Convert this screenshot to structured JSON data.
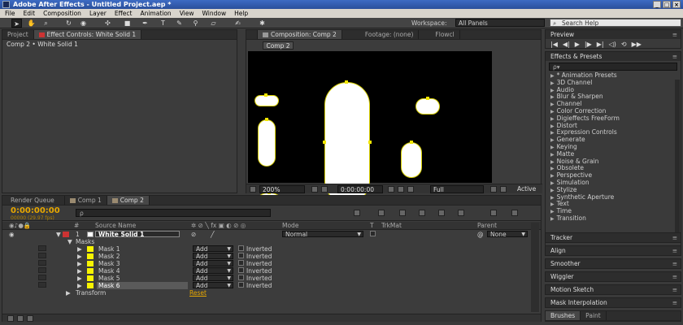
{
  "title_bar": {
    "text": "Adobe After Effects - Untitled Project.aep *"
  },
  "menu": [
    "File",
    "Edit",
    "Composition",
    "Layer",
    "Effect",
    "Animation",
    "View",
    "Window",
    "Help"
  ],
  "toolbar": {
    "workspace_label": "Workspace:",
    "workspace_value": "All Panels",
    "help_placeholder": "Search Help"
  },
  "left_panel": {
    "tabs": [
      "Project",
      "Effect Controls: White Solid 1"
    ],
    "breadcrumb": "Comp 2 • White Solid 1"
  },
  "comp_panel": {
    "tabs": [
      "Composition: Comp 2",
      "Footage: (none)",
      "Flowcl"
    ],
    "subtab": "Comp 2",
    "zoom": "200%",
    "timecode": "0:00:00:00",
    "resolution": "Full",
    "view": "Active"
  },
  "right": {
    "preview_title": "Preview",
    "effects_title": "Effects & Presets",
    "effects_search": "ρ▾",
    "effects": [
      "* Animation Presets",
      "3D Channel",
      "Audio",
      "Blur & Sharpen",
      "Channel",
      "Color Correction",
      "Digieffects FreeForm",
      "Distort",
      "Expression Controls",
      "Generate",
      "Keying",
      "Matte",
      "Noise & Grain",
      "Obsolete",
      "Perspective",
      "Simulation",
      "Stylize",
      "Synthetic Aperture",
      "Text",
      "Time",
      "Transition"
    ],
    "panels": [
      "Tracker",
      "Align",
      "Smoother",
      "Wiggler",
      "Motion Sketch",
      "Mask Interpolation"
    ],
    "bottom_tabs": [
      "Brushes",
      "Paint"
    ]
  },
  "timeline": {
    "tabs": [
      "Render Queue",
      "Comp 1",
      "Comp 2"
    ],
    "timecode": "0:00:00:00",
    "frames": "00000 (29.97 fps)",
    "search_placeholder": "ρ",
    "columns": {
      "num": "#",
      "source": "Source Name",
      "mode": "Mode",
      "t": "T",
      "trkmat": "TrkMat",
      "parent": "Parent"
    },
    "layer": {
      "num": "1",
      "name": "White Solid 1",
      "mode": "Normal",
      "parent": "None"
    },
    "masks_label": "Masks",
    "masks": [
      {
        "name": "Mask 1",
        "mode": "Add",
        "inverted": "Inverted"
      },
      {
        "name": "Mask 2",
        "mode": "Add",
        "inverted": "Inverted"
      },
      {
        "name": "Mask 3",
        "mode": "Add",
        "inverted": "Inverted"
      },
      {
        "name": "Mask 4",
        "mode": "Add",
        "inverted": "Inverted"
      },
      {
        "name": "Mask 5",
        "mode": "Add",
        "inverted": "Inverted"
      },
      {
        "name": "Mask 6",
        "mode": "Add",
        "inverted": "Inverted"
      }
    ],
    "transform_label": "Transform",
    "reset_label": "Reset"
  },
  "colors": {
    "timecode": "#e8a800",
    "mask_swatch": "#f8f400",
    "mask_path": "#d8d000"
  }
}
